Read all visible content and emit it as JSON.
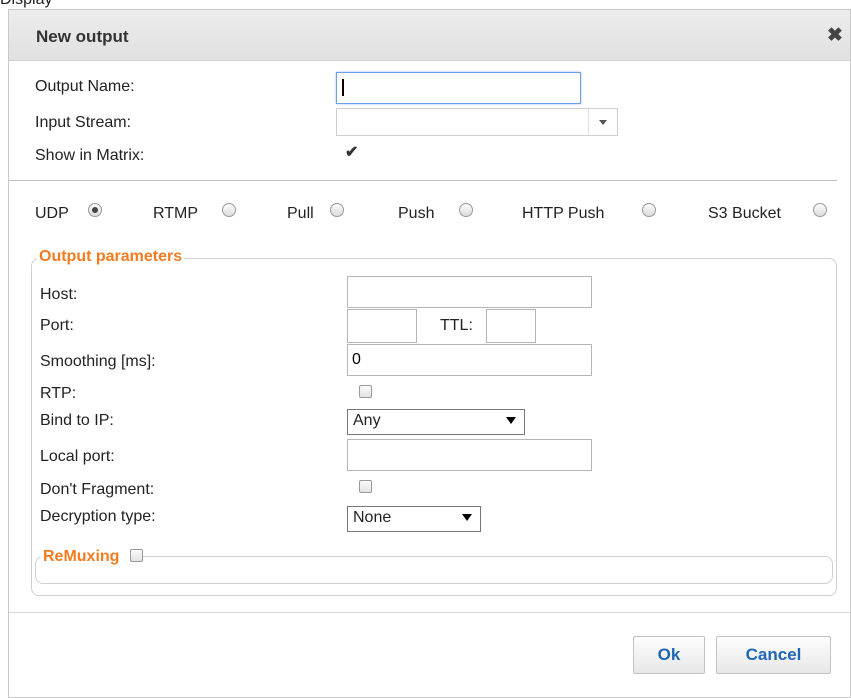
{
  "background_text": "Display",
  "dialog": {
    "title": "New output",
    "close_icon": "close-icon"
  },
  "form": {
    "output_name_label": "Output Name:",
    "output_name_value": "",
    "input_stream_label": "Input Stream:",
    "input_stream_value": "",
    "show_in_matrix_label": "Show in Matrix:",
    "show_in_matrix_checked": true
  },
  "output_types": [
    {
      "label": "UDP",
      "selected": true
    },
    {
      "label": "RTMP",
      "selected": false
    },
    {
      "label": "Pull",
      "selected": false
    },
    {
      "label": "Push",
      "selected": false
    },
    {
      "label": "HTTP Push",
      "selected": false
    },
    {
      "label": "S3 Bucket",
      "selected": false
    }
  ],
  "params": {
    "legend": "Output parameters",
    "host_label": "Host:",
    "host_value": "",
    "port_label": "Port:",
    "port_value": "",
    "ttl_label": "TTL:",
    "ttl_value": "",
    "smoothing_label": "Smoothing [ms]:",
    "smoothing_value": "0",
    "rtp_label": "RTP:",
    "rtp_checked": false,
    "bind_label": "Bind to IP:",
    "bind_value": "Any",
    "local_port_label": "Local port:",
    "local_port_value": "",
    "dont_fragment_label": "Don't Fragment:",
    "dont_fragment_checked": false,
    "decryption_label": "Decryption type:",
    "decryption_value": "None"
  },
  "remuxing": {
    "legend": "ReMuxing",
    "checked": false
  },
  "buttons": {
    "ok": "Ok",
    "cancel": "Cancel"
  },
  "colors": {
    "accent_orange": "#f47b20",
    "button_text_blue": "#1f66b5"
  }
}
